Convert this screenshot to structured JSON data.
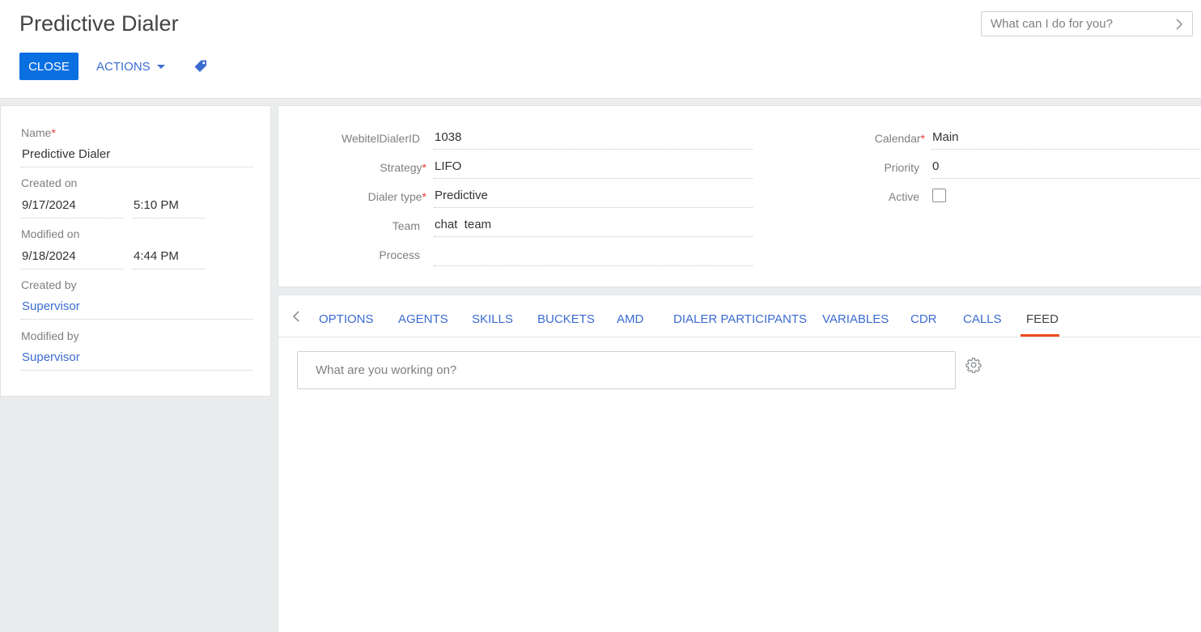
{
  "header": {
    "title": "Predictive Dialer",
    "close_label": "CLOSE",
    "actions_label": "ACTIONS",
    "search_placeholder": "What can I do for you?"
  },
  "left_panel": {
    "name_label": "Name",
    "name_value": "Predictive Dialer",
    "created_on_label": "Created on",
    "created_date": "9/17/2024",
    "created_time": "5:10 PM",
    "modified_on_label": "Modified on",
    "modified_date": "9/18/2024",
    "modified_time": "4:44 PM",
    "created_by_label": "Created by",
    "created_by_value": "Supervisor",
    "modified_by_label": "Modified by",
    "modified_by_value": "Supervisor"
  },
  "record": {
    "dialer_id_label": "WebitelDialerID",
    "dialer_id_value": "1038",
    "strategy_label": "Strategy",
    "strategy_value": "LIFO",
    "dialer_type_label": "Dialer type",
    "dialer_type_value": "Predictive",
    "team_label": "Team",
    "team_value": "chat  team",
    "process_label": "Process",
    "process_value": "",
    "calendar_label": "Calendar",
    "calendar_value": "Main",
    "priority_label": "Priority",
    "priority_value": "0",
    "active_label": "Active",
    "active_checked": false
  },
  "tabs": {
    "items": [
      "OPTIONS",
      "AGENTS",
      "SKILLS",
      "BUCKETS",
      "AMD",
      "DIALER PARTICIPANTS",
      "VARIABLES",
      "CDR",
      "CALLS",
      "FEED"
    ],
    "active": "FEED"
  },
  "feed": {
    "placeholder": "What are you working on?"
  },
  "colors": {
    "primary": "#0a6fe1",
    "link": "#3b6bd1",
    "active_tab_underline": "#f04b1d",
    "required": "#e23b3b"
  }
}
